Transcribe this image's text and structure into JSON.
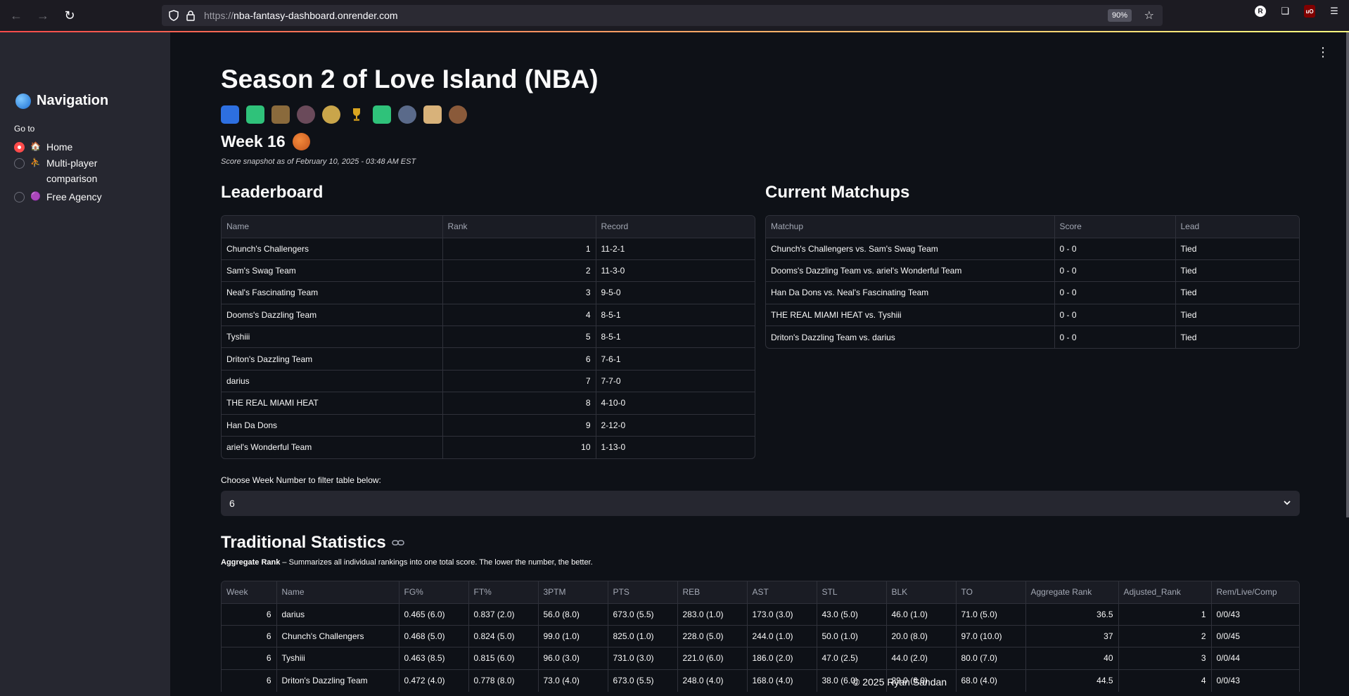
{
  "browser": {
    "url_proto": "https://",
    "url_host": "nba-fantasy-dashboard.onrender.com",
    "zoom": "90%"
  },
  "sidebar": {
    "title": "Navigation",
    "goto_label": "Go to",
    "items": [
      {
        "emoji": "🏠",
        "label": "Home",
        "selected": true
      },
      {
        "emoji": "⛹",
        "label": "Multi-player comparison",
        "selected": false
      },
      {
        "emoji": "🟣",
        "label": "Free Agency",
        "selected": false
      }
    ]
  },
  "main": {
    "title": "Season 2 of Love Island (NBA)",
    "week_title": "Week 16",
    "snapshot": "Score snapshot as of February 10, 2025 - 03:48 AM EST",
    "leaderboard": {
      "title": "Leaderboard",
      "columns": [
        "Name",
        "Rank",
        "Record"
      ],
      "rows": [
        [
          "Chunch's Challengers",
          "1",
          "11-2-1"
        ],
        [
          "Sam's Swag Team",
          "2",
          "11-3-0"
        ],
        [
          "Neal's Fascinating Team",
          "3",
          "9-5-0"
        ],
        [
          "Dooms's Dazzling Team",
          "4",
          "8-5-1"
        ],
        [
          "Tyshiii",
          "5",
          "8-5-1"
        ],
        [
          "Driton's Dazzling Team",
          "6",
          "7-6-1"
        ],
        [
          "darius",
          "7",
          "7-7-0"
        ],
        [
          "THE REAL MIAMI HEAT",
          "8",
          "4-10-0"
        ],
        [
          "Han Da Dons",
          "9",
          "2-12-0"
        ],
        [
          "ariel's Wonderful Team",
          "10",
          "1-13-0"
        ]
      ]
    },
    "matchups": {
      "title": "Current Matchups",
      "columns": [
        "Matchup",
        "Score",
        "Lead"
      ],
      "rows": [
        [
          "Chunch's Challengers vs. Sam's Swag Team",
          "0 - 0",
          "Tied"
        ],
        [
          "Dooms's Dazzling Team vs. ariel's Wonderful Team",
          "0 - 0",
          "Tied"
        ],
        [
          "Han Da Dons vs. Neal's Fascinating Team",
          "0 - 0",
          "Tied"
        ],
        [
          "THE REAL MIAMI HEAT vs. Tyshiii",
          "0 - 0",
          "Tied"
        ],
        [
          "Driton's Dazzling Team vs. darius",
          "0 - 0",
          "Tied"
        ]
      ]
    },
    "filter": {
      "label": "Choose Week Number to filter table below:",
      "value": "6"
    },
    "traditional": {
      "title": "Traditional Statistics",
      "desc_bold": "Aggregate Rank",
      "desc_rest": " – Summarizes all individual rankings into one total score. The lower the number, the better.",
      "columns": [
        "Week",
        "Name",
        "FG%",
        "FT%",
        "3PTM",
        "PTS",
        "REB",
        "AST",
        "STL",
        "BLK",
        "TO",
        "Aggregate Rank",
        "Adjusted_Rank",
        "Rem/Live/Comp"
      ],
      "rows": [
        [
          "6",
          "darius",
          "0.465 (6.0)",
          "0.837 (2.0)",
          "56.0 (8.0)",
          "673.0 (5.5)",
          "283.0 (1.0)",
          "173.0 (3.0)",
          "43.0 (5.0)",
          "46.0 (1.0)",
          "71.0 (5.0)",
          "36.5",
          "1",
          "0/0/43"
        ],
        [
          "6",
          "Chunch's Challengers",
          "0.468 (5.0)",
          "0.824 (5.0)",
          "99.0 (1.0)",
          "825.0 (1.0)",
          "228.0 (5.0)",
          "244.0 (1.0)",
          "50.0 (1.0)",
          "20.0 (8.0)",
          "97.0 (10.0)",
          "37",
          "2",
          "0/0/45"
        ],
        [
          "6",
          "Tyshiii",
          "0.463 (8.5)",
          "0.815 (6.0)",
          "96.0 (3.0)",
          "731.0 (3.0)",
          "221.0 (6.0)",
          "186.0 (2.0)",
          "47.0 (2.5)",
          "44.0 (2.0)",
          "80.0 (7.0)",
          "40",
          "3",
          "0/0/44"
        ],
        [
          "6",
          "Driton's Dazzling Team",
          "0.472 (4.0)",
          "0.778 (8.0)",
          "73.0 (4.0)",
          "673.0 (5.5)",
          "248.0 (4.0)",
          "168.0 (4.0)",
          "38.0 (6.0)",
          "29.0 (6.0)",
          "68.0 (4.0)",
          "44.5",
          "4",
          "0/0/43"
        ]
      ]
    },
    "footer": "© 2025 Ryan Sandan"
  }
}
